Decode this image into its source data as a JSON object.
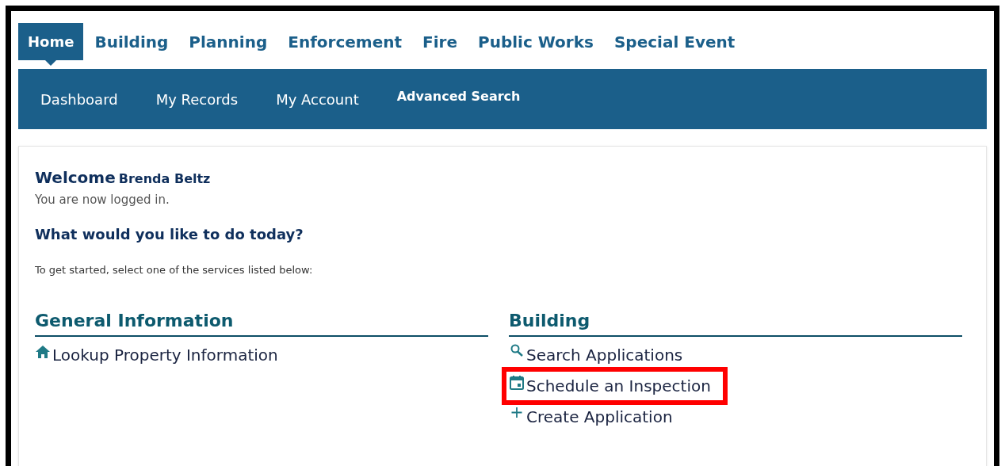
{
  "top_tabs": [
    {
      "label": "Home",
      "selected": true
    },
    {
      "label": "Building",
      "selected": false
    },
    {
      "label": "Planning",
      "selected": false
    },
    {
      "label": "Enforcement",
      "selected": false
    },
    {
      "label": "Fire",
      "selected": false
    },
    {
      "label": "Public Works",
      "selected": false
    },
    {
      "label": "Special Event",
      "selected": false
    }
  ],
  "sub_nav": [
    {
      "label": "Dashboard",
      "kind": "regular"
    },
    {
      "label": "My Records",
      "kind": "regular"
    },
    {
      "label": "My Account",
      "kind": "regular"
    },
    {
      "label": "Advanced Search",
      "kind": "small"
    }
  ],
  "welcome": {
    "title": "Welcome",
    "user": "Brenda Beltz",
    "status": "You are now logged in."
  },
  "question": "What would you like to do today?",
  "instructions": "To get started, select one of the services listed below:",
  "sections": [
    {
      "title": "General Information",
      "links": [
        {
          "label": "Lookup Property Information",
          "kind": "home",
          "highlighted": false
        }
      ]
    },
    {
      "title": "Building",
      "links": [
        {
          "label": "Search Applications",
          "kind": "search",
          "highlighted": false
        },
        {
          "label": "Schedule an Inspection",
          "kind": "calendar",
          "highlighted": true
        },
        {
          "label": "Create Application",
          "kind": "plus",
          "highlighted": false
        }
      ]
    }
  ]
}
